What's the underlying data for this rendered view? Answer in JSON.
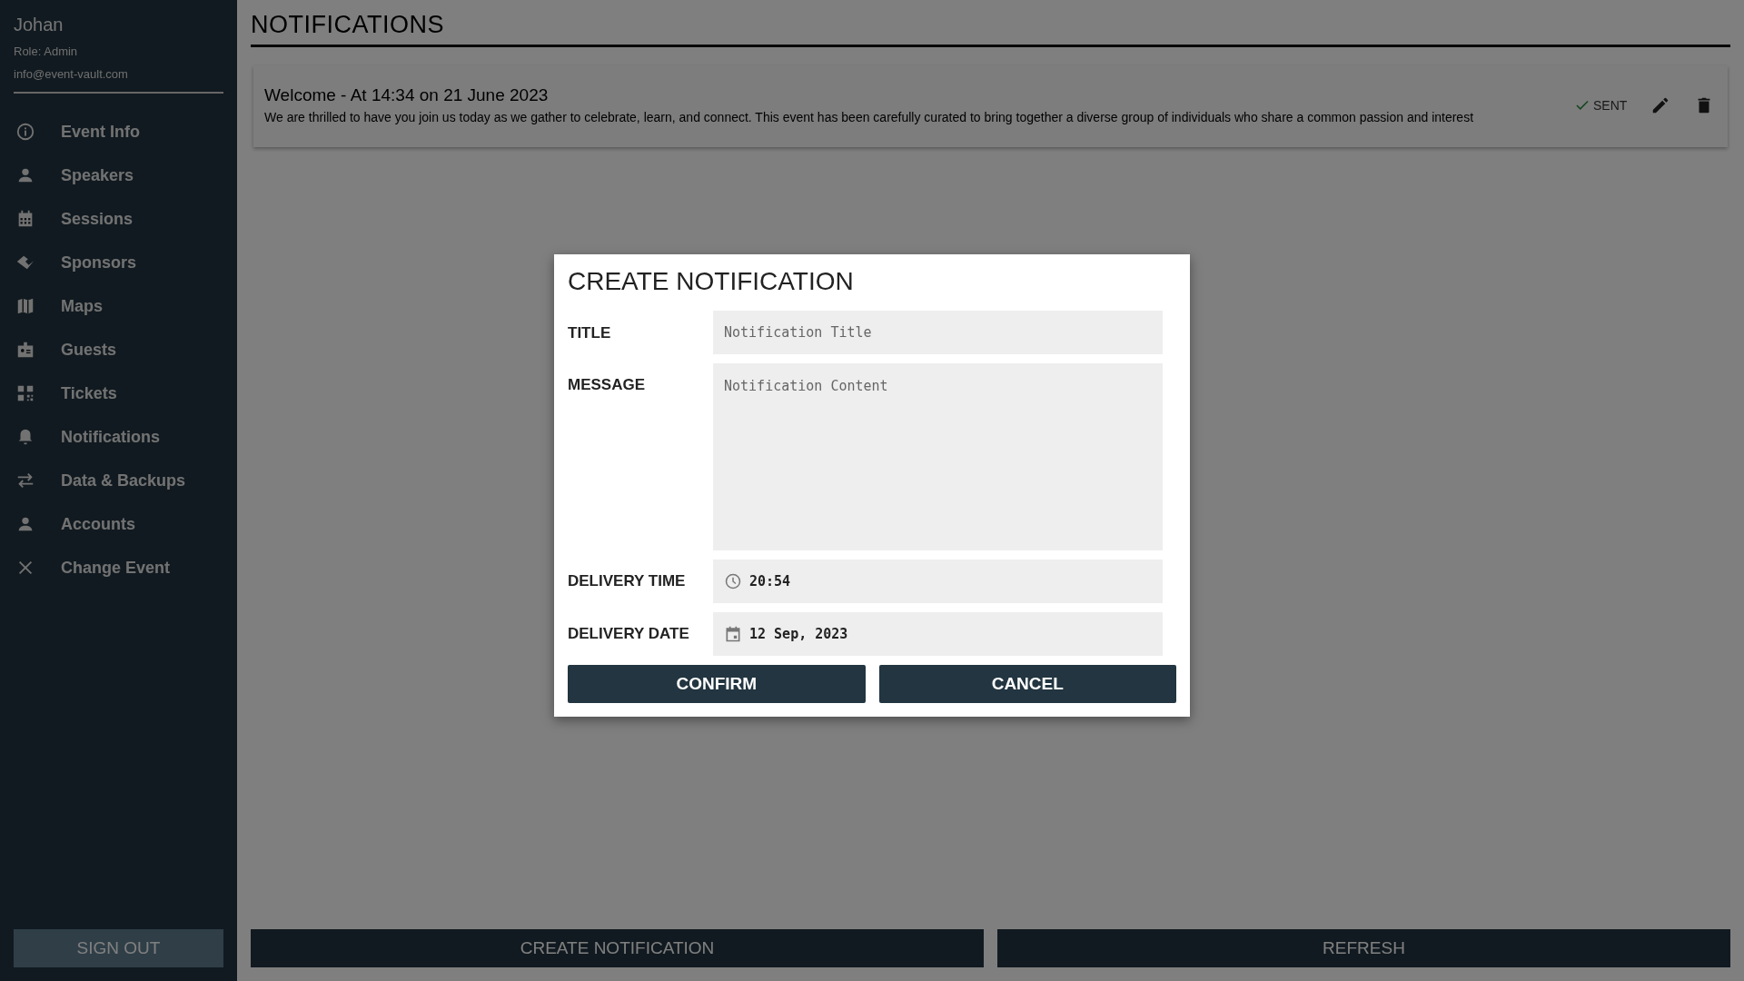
{
  "sidebar": {
    "user": {
      "name": "Johan",
      "role": "Role: Admin",
      "email": "info@event-vault.com"
    },
    "items": [
      {
        "label": "Event Info"
      },
      {
        "label": "Speakers"
      },
      {
        "label": "Sessions"
      },
      {
        "label": "Sponsors"
      },
      {
        "label": "Maps"
      },
      {
        "label": "Guests"
      },
      {
        "label": "Tickets"
      },
      {
        "label": "Notifications"
      },
      {
        "label": "Data & Backups"
      },
      {
        "label": "Accounts"
      },
      {
        "label": "Change Event"
      }
    ],
    "sign_out": "SIGN OUT"
  },
  "page": {
    "title": "NOTIFICATIONS",
    "notifications": [
      {
        "title": "Welcome - At 14:34 on 21 June 2023",
        "message": "We are thrilled to have you join us today as we gather to celebrate, learn, and connect. This event has been carefully curated to bring together a diverse group of individuals who share a common passion and interest",
        "status": "SENT",
        "sent": true
      }
    ],
    "buttons": [
      "CREATE NOTIFICATION",
      "REFRESH"
    ]
  },
  "dialog": {
    "title": "CREATE NOTIFICATION",
    "fields": [
      {
        "label": "TITLE",
        "kind": "text",
        "placeholder": "Notification Title"
      },
      {
        "label": "MESSAGE",
        "kind": "textarea",
        "placeholder": "Notification Content"
      },
      {
        "label": "DELIVERY TIME",
        "kind": "time",
        "value": "20:54"
      },
      {
        "label": "DELIVERY DATE",
        "kind": "date",
        "value": "12 Sep, 2023"
      }
    ],
    "buttons": [
      "CONFIRM",
      "CANCEL"
    ]
  }
}
